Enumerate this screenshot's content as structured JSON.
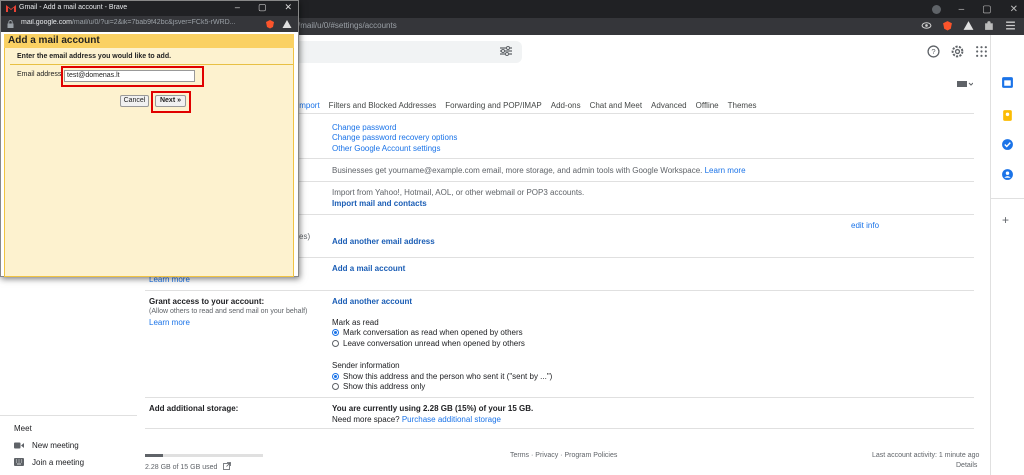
{
  "main_browser": {
    "url_visible": "/mail/u/0/#settings/accounts"
  },
  "tabs": [
    "Import",
    "Filters and Blocked Addresses",
    "Forwarding and POP/IMAP",
    "Add-ons",
    "Chat and Meet",
    "Advanced",
    "Offline",
    "Themes"
  ],
  "settings": {
    "password_links": [
      "Change password",
      "Change password recovery options",
      "Other Google Account settings"
    ],
    "workspace_text": "Businesses get yourname@example.com email, more storage, and admin tools with Google Workspace.",
    "workspace_link": "Learn more",
    "import_text": "Import from Yahoo!, Hotmail, AOL, or other webmail or POP3 accounts.",
    "import_link": "Import mail and contacts",
    "edit_info": "edit info",
    "partial_es": "es)",
    "add_email": "Add another email address",
    "partial_learn": "Learn more",
    "add_mail_account": "Add a mail account",
    "grant_label": "Grant access to your account:",
    "grant_desc": "(Allow others to read and send mail on your behalf)",
    "grant_learn": "Learn more",
    "add_account": "Add another account",
    "mark_as_read": "Mark as read",
    "mark_opt1": "Mark conversation as read when opened by others",
    "mark_opt2": "Leave conversation unread when opened by others",
    "sender_info": "Sender information",
    "sender_opt1": "Show this address and the person who sent it (\"sent by ...\")",
    "sender_opt2": "Show this address only",
    "storage_label": "Add additional storage:",
    "storage_using": "You are currently using 2.28 GB (15%) of your 15 GB.",
    "storage_need": "Need more space?",
    "storage_link": "Purchase additional storage"
  },
  "meet": {
    "title": "Meet",
    "new_meeting": "New meeting",
    "join_meeting": "Join a meeting"
  },
  "footer": {
    "used": "2.28 GB of 15 GB used",
    "used_fraction": 0.15,
    "links": "Terms · Privacy · Program Policies",
    "activity": "Last account activity: 1 minute ago",
    "details": "Details"
  },
  "popup": {
    "window_title": "Gmail - Add a mail account - Brave",
    "url_host": "mail.google.com",
    "url_path": "/mail/u/0/?ui=2&ik=7bab9f42bc&jsver=FCk5-rWRD...",
    "heading": "Add a mail account",
    "subheading": "Enter the email address you would like to add.",
    "email_label": "Email address:",
    "email_value": "test@domenas.lt",
    "cancel_label": "Cancel",
    "next_label": "Next »"
  }
}
